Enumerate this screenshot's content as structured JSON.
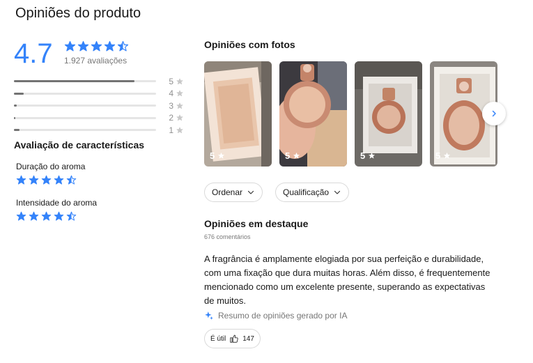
{
  "title": "Opiniões do produto",
  "rating": {
    "score": "4.7",
    "stars": 4.7,
    "count_label": "1.927 avaliações",
    "distribution": [
      {
        "label": "5",
        "fraction": 0.85
      },
      {
        "label": "4",
        "fraction": 0.07
      },
      {
        "label": "3",
        "fraction": 0.02
      },
      {
        "label": "2",
        "fraction": 0.01
      },
      {
        "label": "1",
        "fraction": 0.04
      }
    ]
  },
  "characteristics": {
    "title": "Avaliação de características",
    "items": [
      {
        "name": "Duração do aroma",
        "stars": 4.5
      },
      {
        "name": "Intensidade do aroma",
        "stars": 4.5
      }
    ]
  },
  "photos": {
    "title": "Opiniões com fotos",
    "items": [
      {
        "rating": "5"
      },
      {
        "rating": "5"
      },
      {
        "rating": "5"
      },
      {
        "rating": "5"
      }
    ]
  },
  "filters": {
    "sort_label": "Ordenar",
    "rating_label": "Qualificação"
  },
  "featured": {
    "title": "Opiniões em destaque",
    "count_label": "676 comentários",
    "summary": "A fragrância é amplamente elogiada por sua perfeição e durabilidade, com uma fixação que dura muitas horas. Além disso, é frequentemente mencionado como um excelente presente, superando as expectativas de muitos.",
    "ai_note": "Resumo de opiniões gerado por IA",
    "useful_label": "É útil",
    "useful_count": "147"
  },
  "colors": {
    "accent": "#3483fa",
    "bar": "#737373",
    "track": "#e5e5e5"
  }
}
